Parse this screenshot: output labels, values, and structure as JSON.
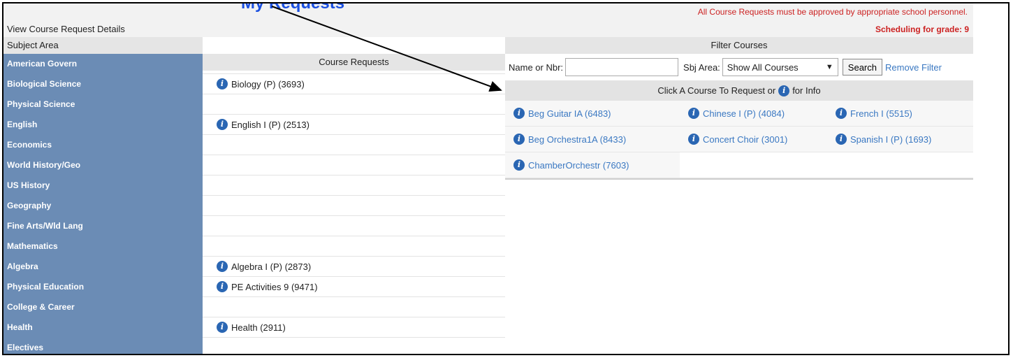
{
  "page": {
    "cutoff_title": "My Requests",
    "view_details": "View Course Request Details",
    "notice": "All Course Requests must be approved by appropriate school personnel.",
    "grade_text": "Scheduling for grade: 9"
  },
  "columns": {
    "subject_area": "Subject Area",
    "course_requests": "Course Requests",
    "filter_courses": "Filter Courses"
  },
  "subjects": [
    {
      "label": "American Govern",
      "request": ""
    },
    {
      "label": "Biological Science",
      "request": "Biology (P) (3693)"
    },
    {
      "label": "Physical Science",
      "request": ""
    },
    {
      "label": "English",
      "request": "English I (P) (2513)"
    },
    {
      "label": "Economics",
      "request": ""
    },
    {
      "label": "World History/Geo",
      "request": ""
    },
    {
      "label": "US History",
      "request": ""
    },
    {
      "label": "Geography",
      "request": ""
    },
    {
      "label": "Fine Arts/Wld Lang",
      "request": ""
    },
    {
      "label": "Mathematics",
      "request": ""
    },
    {
      "label": "Algebra",
      "request": "Algebra I (P) (2873)"
    },
    {
      "label": "Physical Education",
      "request": "PE Activities 9 (9471)"
    },
    {
      "label": "College & Career",
      "request": ""
    },
    {
      "label": "Health",
      "request": "Health (2911)"
    },
    {
      "label": "Electives",
      "request": ""
    }
  ],
  "filter": {
    "name_label": "Name or Nbr:",
    "name_value": "",
    "sbj_label": "Sbj Area:",
    "sbj_selected": "Show All Courses",
    "search_label": "Search",
    "remove_label": "Remove Filter"
  },
  "click_header": {
    "before": "Click A Course To Request or",
    "after": "for Info"
  },
  "courses": [
    "Beg Guitar IA (6483)",
    "Chinese I (P) (4084)",
    "French I (5515)",
    "Beg Orchestra1A (8433)",
    "Concert Choir (3001)",
    "Spanish I (P) (1693)",
    "ChamberOrchestr (7603)"
  ],
  "icons": {
    "info": "info-icon",
    "dropdown": "dropdown-arrow-icon",
    "annotation_arrow": "annotation-arrow"
  },
  "colors": {
    "subject_bg": "#6b8cb5",
    "link": "#3a78c2",
    "notice": "#cc2222",
    "info_icon": "#2a66b3"
  }
}
